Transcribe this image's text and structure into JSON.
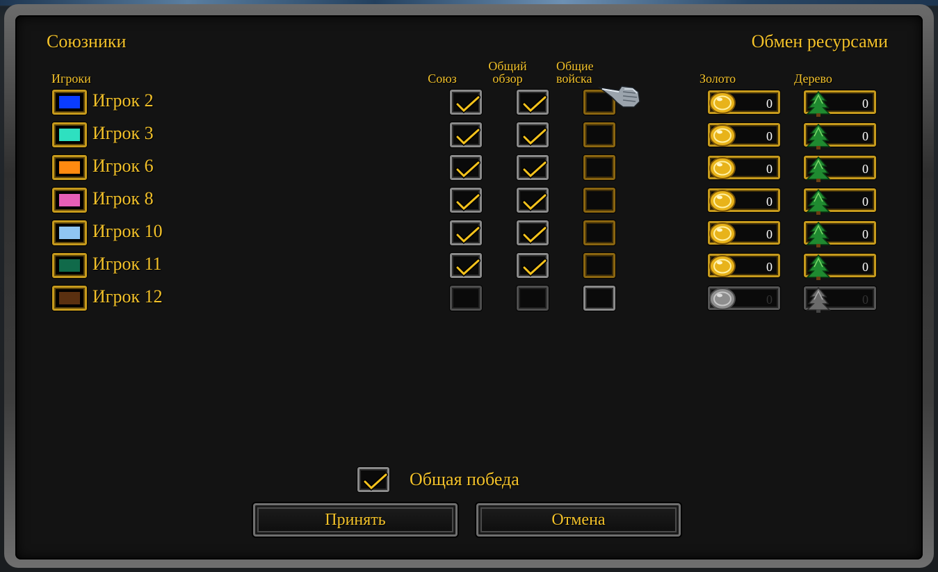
{
  "title_left": "Союзники",
  "title_right": "Обмен ресурсами",
  "headers": {
    "players": "Игроки",
    "alliance": "Союз",
    "shared_vision_line1": "Общий",
    "shared_vision_line2": "обзор",
    "shared_units_line1": "Общие",
    "shared_units_line2": "войска",
    "gold": "Золото",
    "lumber": "Дерево"
  },
  "players": [
    {
      "name": "Игрок 2",
      "color": "#0a3cff",
      "alliance": true,
      "vision": true,
      "units": false,
      "gold": "0",
      "lumber": "0",
      "enabled": true
    },
    {
      "name": "Игрок 3",
      "color": "#2ee0c0",
      "alliance": true,
      "vision": true,
      "units": false,
      "gold": "0",
      "lumber": "0",
      "enabled": true
    },
    {
      "name": "Игрок 6",
      "color": "#ff8a10",
      "alliance": true,
      "vision": true,
      "units": false,
      "gold": "0",
      "lumber": "0",
      "enabled": true
    },
    {
      "name": "Игрок 8",
      "color": "#e85fb7",
      "alliance": true,
      "vision": true,
      "units": false,
      "gold": "0",
      "lumber": "0",
      "enabled": true
    },
    {
      "name": "Игрок 10",
      "color": "#8fc5f2",
      "alliance": true,
      "vision": true,
      "units": false,
      "gold": "0",
      "lumber": "0",
      "enabled": true
    },
    {
      "name": "Игрок 11",
      "color": "#106a4a",
      "alliance": true,
      "vision": true,
      "units": false,
      "gold": "0",
      "lumber": "0",
      "enabled": true
    },
    {
      "name": "Игрок 12",
      "color": "#5a3010",
      "alliance": false,
      "vision": false,
      "units": false,
      "gold": "0",
      "lumber": "0",
      "enabled": false
    }
  ],
  "shared_victory": {
    "label": "Общая победа",
    "checked": true
  },
  "buttons": {
    "accept": "Принять",
    "cancel": "Отмена"
  },
  "icons": {
    "gold": "gold-coin-icon",
    "lumber": "tree-icon",
    "cursor": "gauntlet-cursor-icon",
    "check": "checkmark-icon"
  }
}
